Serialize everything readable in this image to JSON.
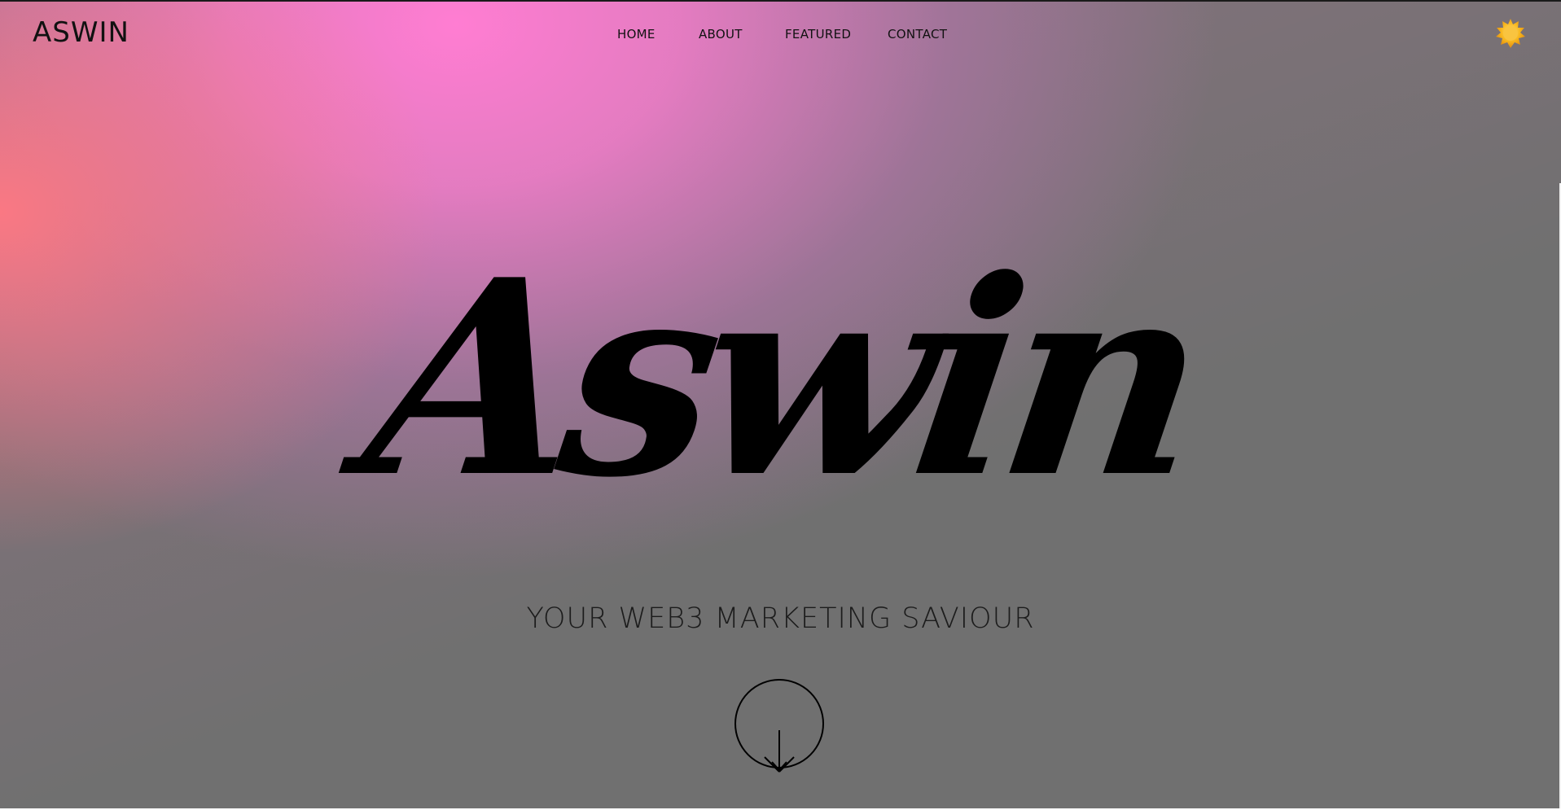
{
  "header": {
    "brand": "ASWIN",
    "nav": [
      {
        "label": "HOME"
      },
      {
        "label": "ABOUT"
      },
      {
        "label": "FEATURED"
      },
      {
        "label": "CONTACT"
      }
    ],
    "theme_icon": "sun-icon"
  },
  "hero": {
    "name": "Aswin",
    "tagline": "YOUR WEB3 MARKETING SAVIOUR",
    "scroll_icon": "arrow-down-circle-icon"
  },
  "colors": {
    "pink": "#ff7dd2",
    "coral": "#ff7882",
    "gray": "#707070",
    "text": "#000000",
    "sun": "#f7b51c"
  }
}
